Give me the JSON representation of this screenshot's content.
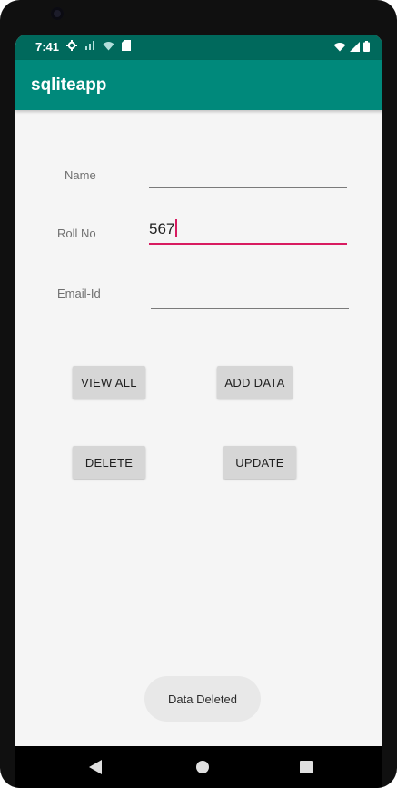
{
  "statusbar": {
    "time": "7:41",
    "icons": [
      "gear-icon",
      "signal-alt-icon",
      "wifi-question-icon",
      "sd-card-icon",
      "wifi-icon",
      "cell-signal-icon",
      "battery-icon"
    ]
  },
  "appbar": {
    "title": "sqliteapp"
  },
  "form": {
    "name_label": "Name",
    "name_value": "",
    "rollno_label": "Roll No",
    "rollno_value": "567",
    "email_label": "Email-Id",
    "email_value": ""
  },
  "buttons": {
    "view_all": "VIEW ALL",
    "add_data": "ADD DATA",
    "delete": "DELETE",
    "update": "UPDATE"
  },
  "toast": {
    "message": "Data Deleted"
  },
  "navbar": {
    "icons": [
      "back-icon",
      "home-icon",
      "recents-icon"
    ]
  },
  "colors": {
    "appbar": "#00897b",
    "statusbar": "#00695c",
    "accent": "#d81b60",
    "background": "#f5f5f5"
  }
}
